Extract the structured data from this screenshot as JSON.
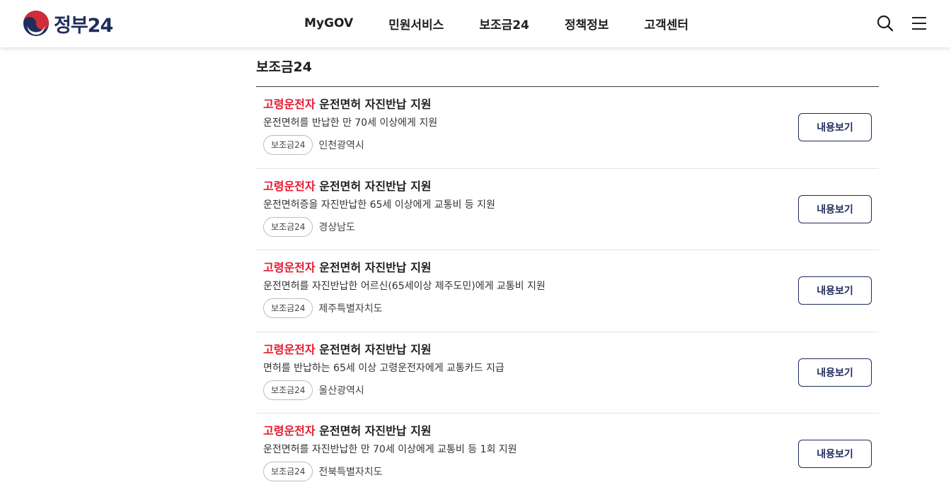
{
  "header": {
    "logo_text": "정부24",
    "logo_icon": "taegeuk-emblem-icon",
    "nav": [
      {
        "label": "MyGOV"
      },
      {
        "label": "민원서비스"
      },
      {
        "label": "보조금24"
      },
      {
        "label": "정책정보"
      },
      {
        "label": "고객센터"
      }
    ],
    "search_icon": "search-icon",
    "menu_icon": "hamburger-menu-icon"
  },
  "section": {
    "title": "보조금24"
  },
  "colors": {
    "highlight": "#e21a2e",
    "brand_navy": "#1f2c5c"
  },
  "items": [
    {
      "title_highlight": "고령운전자",
      "title_rest": " 운전면허 자진반납 지원",
      "description": "운전면허를 반납한 만 70세 이상에게 지원",
      "tag": "보조금24",
      "region": "인천광역시",
      "button_label": "내용보기"
    },
    {
      "title_highlight": "고령운전자",
      "title_rest": " 운전면허 자진반납 지원",
      "description": "운전면허증을 자진반납한 65세 이상에게 교통비 등 지원",
      "tag": "보조금24",
      "region": "경상남도",
      "button_label": "내용보기"
    },
    {
      "title_highlight": "고령운전자",
      "title_rest": " 운전면허 자진반납 지원",
      "description": "운전면허를 자진반납한 어르신(65세이상 제주도민)에게 교통비 지원",
      "tag": "보조금24",
      "region": "제주특별자치도",
      "button_label": "내용보기"
    },
    {
      "title_highlight": "고령운전자",
      "title_rest": " 운전면허 자진반납 지원",
      "description": "면허를 반납하는 65세 이상 고령운전자에게 교통카드 지급",
      "tag": "보조금24",
      "region": "울산광역시",
      "button_label": "내용보기"
    },
    {
      "title_highlight": "고령운전자",
      "title_rest": " 운전면허 자진반납 지원",
      "description": "운전면허를 자진반납한 만 70세 이상에게 교통비 등 1회 지원",
      "tag": "보조금24",
      "region": "전북특별자치도",
      "button_label": "내용보기"
    }
  ]
}
